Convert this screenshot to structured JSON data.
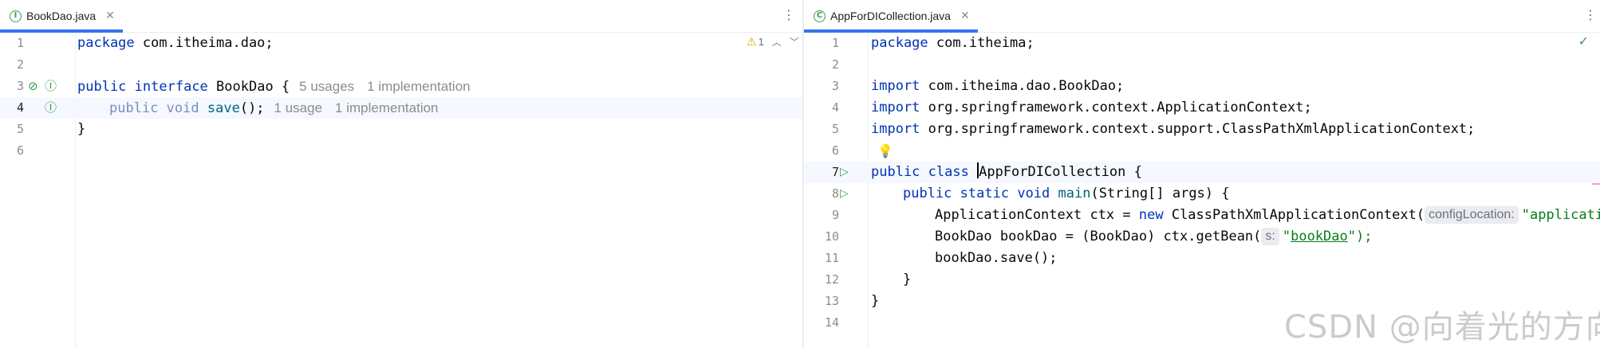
{
  "left": {
    "tab": {
      "icon": "interface-file-icon",
      "label": "BookDao.java"
    },
    "warning": {
      "icon": "warning-icon",
      "count": "1"
    },
    "lines": [
      {
        "n": "1",
        "kw": "package",
        "rest": " com.itheima.dao;"
      },
      {
        "n": "2"
      },
      {
        "n": "3",
        "kw1": "public",
        "kw2": "interface",
        "name": " BookDao {",
        "hint1": "5 usages",
        "hint2": "1 implementation"
      },
      {
        "n": "4",
        "kw1": "public",
        "kw2": "void",
        "fn": "save",
        "rest": "();",
        "hint1": "1 usage",
        "hint2": "1 implementation"
      },
      {
        "n": "5",
        "text": "}"
      },
      {
        "n": "6"
      }
    ]
  },
  "right": {
    "tab": {
      "icon": "class-file-icon",
      "label": "AppForDICollection.java"
    },
    "status": "check-icon",
    "lines": [
      {
        "n": "1",
        "kw": "package",
        "rest": " com.itheima;"
      },
      {
        "n": "2"
      },
      {
        "n": "3",
        "kw": "import",
        "rest": " com.itheima.dao.BookDao;"
      },
      {
        "n": "4",
        "kw": "import",
        "rest": " org.springframework.context.ApplicationContext;"
      },
      {
        "n": "5",
        "kw": "import",
        "rest": " org.springframework.context.support.ClassPathXmlApplicationContext;"
      },
      {
        "n": "6"
      },
      {
        "n": "7",
        "kw1": "public",
        "kw2": "class",
        "name_pre": "",
        "name": "AppForDICollection {"
      },
      {
        "n": "8",
        "kw1": "public",
        "kw2": "static",
        "kw3": "void",
        "fn": "main",
        "rest": "(String[] args) {"
      },
      {
        "n": "9",
        "pre": "ApplicationContext ctx = ",
        "kw": "new",
        "mid": " ClassPathXmlApplicationContext(",
        "param": "configLocation:",
        "str": "\"applicati"
      },
      {
        "n": "10",
        "pre": "BookDao bookDao = (BookDao) ctx.getBean(",
        "param": "s:",
        "q1": "\"",
        "link": "bookDao",
        "q2": "\");"
      },
      {
        "n": "11",
        "text": "bookDao.save();"
      },
      {
        "n": "12",
        "text": "}"
      },
      {
        "n": "13",
        "text": "}"
      },
      {
        "n": "14"
      }
    ]
  },
  "watermark": "CSDN @向着光的方向j"
}
